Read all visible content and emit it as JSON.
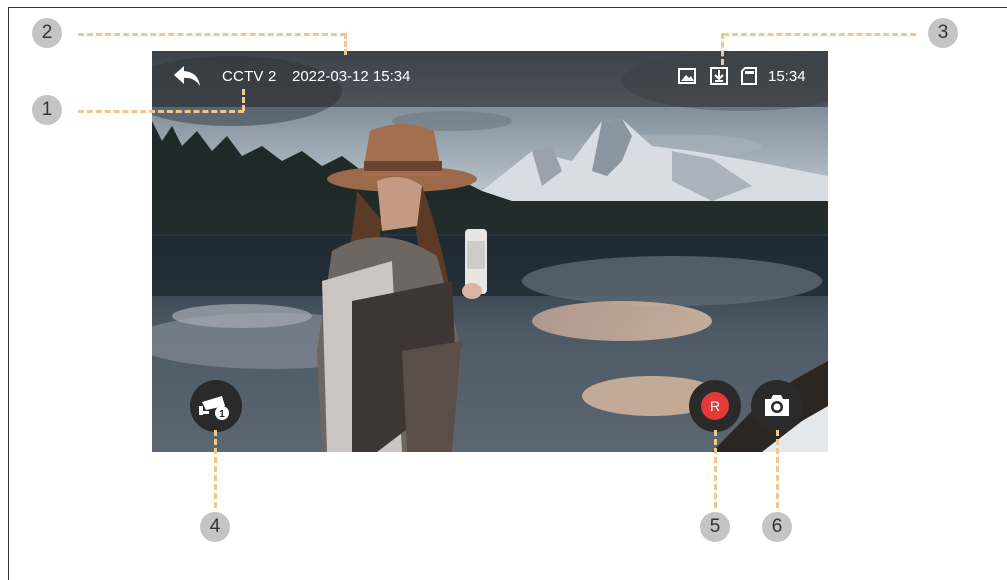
{
  "topbar": {
    "channel": "CCTV 2",
    "datetime": "2022-03-12 15:34",
    "clock": "15:34",
    "icons": [
      "back-arrow-icon",
      "gallery-icon",
      "download-icon",
      "sd-card-icon"
    ]
  },
  "controls": {
    "cctv_badge": "1",
    "record_label": "R",
    "icons": [
      "cctv-camera-icon",
      "record-icon",
      "snapshot-camera-icon"
    ]
  },
  "callouts": [
    "1",
    "2",
    "3",
    "4",
    "5",
    "6"
  ],
  "colors": {
    "callout_bg": "#c4c4c4",
    "dash": "#f0c98a",
    "record_red": "#e53935",
    "button_dark": "#2a2a2a"
  }
}
